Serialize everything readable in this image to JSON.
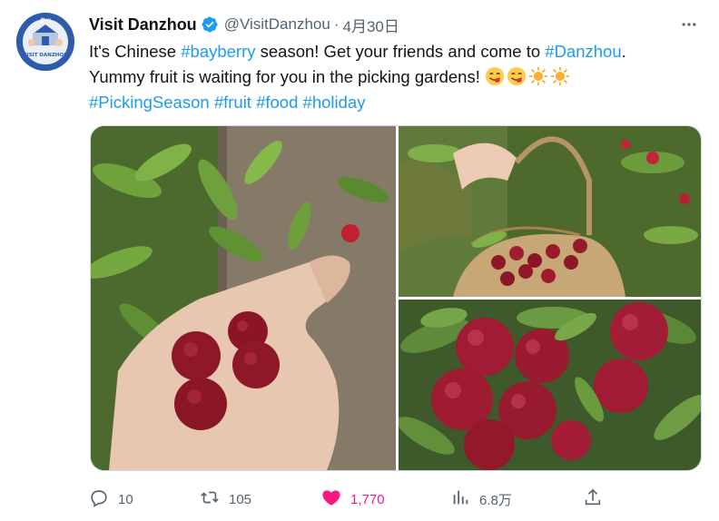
{
  "tweet": {
    "display_name": "Visit Danzhou",
    "handle": "@VisitDanzhou",
    "separator": "·",
    "date": "4月30日",
    "text": {
      "line1_prefix": "It's Chinese ",
      "tag_bayberry": "#bayberry",
      "line1_mid": " season! Get your friends and come to ",
      "tag_danzhou": "#Danzhou",
      "line1_end": ".",
      "line2": "Yummy fruit is waiting for you in the picking gardens!",
      "tag_picking": "#PickingSeason",
      "tag_fruit": "#fruit",
      "tag_food": "#food",
      "tag_holiday": "#holiday"
    },
    "avatar_text": "VISIT DANZHOU",
    "avatar_logo": "儋州"
  },
  "actions": {
    "replies": "10",
    "retweets": "105",
    "likes": "1,770",
    "views": "6.8万"
  },
  "colors": {
    "link": "#1d9bf0",
    "like": "#f91880",
    "muted": "#536471",
    "verified": "#1d9bf0"
  },
  "icons": [
    "verified-icon",
    "more-icon",
    "reply-icon",
    "retweet-icon",
    "like-icon",
    "views-icon",
    "share-icon",
    "yum-emoji",
    "sun-emoji"
  ]
}
